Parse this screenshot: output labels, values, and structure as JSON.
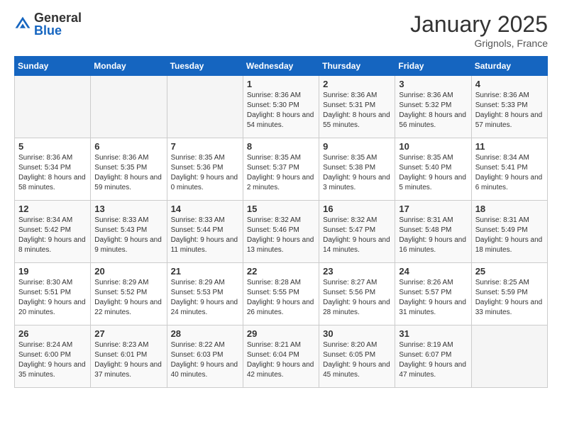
{
  "header": {
    "logo_general": "General",
    "logo_blue": "Blue",
    "month_title": "January 2025",
    "location": "Grignols, France"
  },
  "weekdays": [
    "Sunday",
    "Monday",
    "Tuesday",
    "Wednesday",
    "Thursday",
    "Friday",
    "Saturday"
  ],
  "weeks": [
    [
      {
        "day": "",
        "detail": ""
      },
      {
        "day": "",
        "detail": ""
      },
      {
        "day": "",
        "detail": ""
      },
      {
        "day": "1",
        "detail": "Sunrise: 8:36 AM\nSunset: 5:30 PM\nDaylight: 8 hours\nand 54 minutes."
      },
      {
        "day": "2",
        "detail": "Sunrise: 8:36 AM\nSunset: 5:31 PM\nDaylight: 8 hours\nand 55 minutes."
      },
      {
        "day": "3",
        "detail": "Sunrise: 8:36 AM\nSunset: 5:32 PM\nDaylight: 8 hours\nand 56 minutes."
      },
      {
        "day": "4",
        "detail": "Sunrise: 8:36 AM\nSunset: 5:33 PM\nDaylight: 8 hours\nand 57 minutes."
      }
    ],
    [
      {
        "day": "5",
        "detail": "Sunrise: 8:36 AM\nSunset: 5:34 PM\nDaylight: 8 hours\nand 58 minutes."
      },
      {
        "day": "6",
        "detail": "Sunrise: 8:36 AM\nSunset: 5:35 PM\nDaylight: 8 hours\nand 59 minutes."
      },
      {
        "day": "7",
        "detail": "Sunrise: 8:35 AM\nSunset: 5:36 PM\nDaylight: 9 hours\nand 0 minutes."
      },
      {
        "day": "8",
        "detail": "Sunrise: 8:35 AM\nSunset: 5:37 PM\nDaylight: 9 hours\nand 2 minutes."
      },
      {
        "day": "9",
        "detail": "Sunrise: 8:35 AM\nSunset: 5:38 PM\nDaylight: 9 hours\nand 3 minutes."
      },
      {
        "day": "10",
        "detail": "Sunrise: 8:35 AM\nSunset: 5:40 PM\nDaylight: 9 hours\nand 5 minutes."
      },
      {
        "day": "11",
        "detail": "Sunrise: 8:34 AM\nSunset: 5:41 PM\nDaylight: 9 hours\nand 6 minutes."
      }
    ],
    [
      {
        "day": "12",
        "detail": "Sunrise: 8:34 AM\nSunset: 5:42 PM\nDaylight: 9 hours\nand 8 minutes."
      },
      {
        "day": "13",
        "detail": "Sunrise: 8:33 AM\nSunset: 5:43 PM\nDaylight: 9 hours\nand 9 minutes."
      },
      {
        "day": "14",
        "detail": "Sunrise: 8:33 AM\nSunset: 5:44 PM\nDaylight: 9 hours\nand 11 minutes."
      },
      {
        "day": "15",
        "detail": "Sunrise: 8:32 AM\nSunset: 5:46 PM\nDaylight: 9 hours\nand 13 minutes."
      },
      {
        "day": "16",
        "detail": "Sunrise: 8:32 AM\nSunset: 5:47 PM\nDaylight: 9 hours\nand 14 minutes."
      },
      {
        "day": "17",
        "detail": "Sunrise: 8:31 AM\nSunset: 5:48 PM\nDaylight: 9 hours\nand 16 minutes."
      },
      {
        "day": "18",
        "detail": "Sunrise: 8:31 AM\nSunset: 5:49 PM\nDaylight: 9 hours\nand 18 minutes."
      }
    ],
    [
      {
        "day": "19",
        "detail": "Sunrise: 8:30 AM\nSunset: 5:51 PM\nDaylight: 9 hours\nand 20 minutes."
      },
      {
        "day": "20",
        "detail": "Sunrise: 8:29 AM\nSunset: 5:52 PM\nDaylight: 9 hours\nand 22 minutes."
      },
      {
        "day": "21",
        "detail": "Sunrise: 8:29 AM\nSunset: 5:53 PM\nDaylight: 9 hours\nand 24 minutes."
      },
      {
        "day": "22",
        "detail": "Sunrise: 8:28 AM\nSunset: 5:55 PM\nDaylight: 9 hours\nand 26 minutes."
      },
      {
        "day": "23",
        "detail": "Sunrise: 8:27 AM\nSunset: 5:56 PM\nDaylight: 9 hours\nand 28 minutes."
      },
      {
        "day": "24",
        "detail": "Sunrise: 8:26 AM\nSunset: 5:57 PM\nDaylight: 9 hours\nand 31 minutes."
      },
      {
        "day": "25",
        "detail": "Sunrise: 8:25 AM\nSunset: 5:59 PM\nDaylight: 9 hours\nand 33 minutes."
      }
    ],
    [
      {
        "day": "26",
        "detail": "Sunrise: 8:24 AM\nSunset: 6:00 PM\nDaylight: 9 hours\nand 35 minutes."
      },
      {
        "day": "27",
        "detail": "Sunrise: 8:23 AM\nSunset: 6:01 PM\nDaylight: 9 hours\nand 37 minutes."
      },
      {
        "day": "28",
        "detail": "Sunrise: 8:22 AM\nSunset: 6:03 PM\nDaylight: 9 hours\nand 40 minutes."
      },
      {
        "day": "29",
        "detail": "Sunrise: 8:21 AM\nSunset: 6:04 PM\nDaylight: 9 hours\nand 42 minutes."
      },
      {
        "day": "30",
        "detail": "Sunrise: 8:20 AM\nSunset: 6:05 PM\nDaylight: 9 hours\nand 45 minutes."
      },
      {
        "day": "31",
        "detail": "Sunrise: 8:19 AM\nSunset: 6:07 PM\nDaylight: 9 hours\nand 47 minutes."
      },
      {
        "day": "",
        "detail": ""
      }
    ]
  ]
}
